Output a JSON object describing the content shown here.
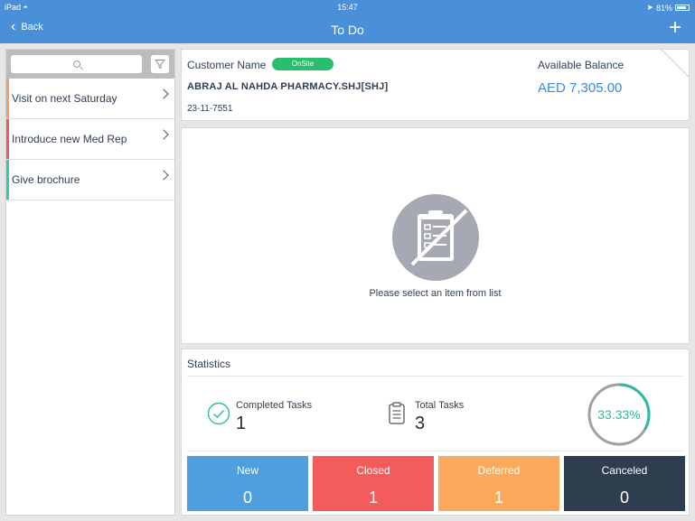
{
  "status_bar": {
    "device": "iPad",
    "time": "15:47",
    "battery": "81%"
  },
  "nav": {
    "back_label": "Back",
    "title": "To Do",
    "add_label": "+"
  },
  "sidebar": {
    "search_placeholder": "",
    "items": [
      {
        "label": "Visit on next Saturday",
        "color": "#f5a05a"
      },
      {
        "label": "Introduce new Med Rep",
        "color": "#ef5b5b"
      },
      {
        "label": "Give brochure",
        "color": "#3cc7a8"
      }
    ]
  },
  "customer": {
    "label": "Customer Name",
    "status": "OnSite",
    "name": "ABRAJ AL NAHDA PHARMACY.SHJ[SHJ]",
    "code": "23-11-7551",
    "balance_label": "Available Balance",
    "balance_value": "AED 7,305.00"
  },
  "detail": {
    "empty_message": "Please select an item from list"
  },
  "statistics": {
    "title": "Statistics",
    "completed_label": "Completed Tasks",
    "completed_value": "1",
    "total_label": "Total Tasks",
    "total_value": "3",
    "percent": "33.33%",
    "percent_fraction": 0.3333,
    "tiles": [
      {
        "label": "New",
        "value": "0",
        "color": "#4f9ee0"
      },
      {
        "label": "Closed",
        "value": "1",
        "color": "#f45b5b"
      },
      {
        "label": "Deferred",
        "value": "1",
        "color": "#fbaa5c"
      },
      {
        "label": "Canceled",
        "value": "0",
        "color": "#2f3e4e"
      }
    ]
  },
  "colors": {
    "header": "#4a90d9",
    "accent_green": "#2bbd6e",
    "ring": "#2bbd9c"
  }
}
